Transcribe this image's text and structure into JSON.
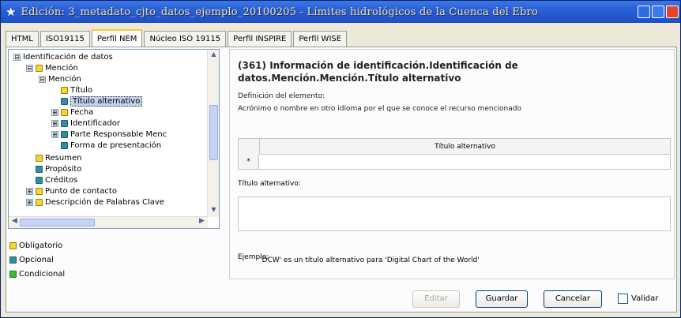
{
  "window": {
    "title": "Edición: 3_metadato_cjto_datos_ejemplo_20100205 - Límites hidrológicos de la Cuenca del Ebro",
    "colors": {
      "titlebar": "#2a5fd6",
      "title_text": "#f5e4a0",
      "required": "#f5d33a",
      "optional": "#2f8fa0",
      "conditional": "#3aba3a"
    }
  },
  "tabs": [
    {
      "label": "HTML",
      "active": false
    },
    {
      "label": "ISO19115",
      "active": false
    },
    {
      "label": "Perfil NEM",
      "active": true
    },
    {
      "label": "Núcleo ISO 19115",
      "active": false
    },
    {
      "label": "Perfil INSPIRE",
      "active": false
    },
    {
      "label": "Perfil WISE",
      "active": false
    }
  ],
  "tree": {
    "nodes": [
      {
        "label": "Identificación de datos",
        "expander": "⊟",
        "icon": ""
      },
      {
        "label": "Mención",
        "expander": "⊟",
        "icon": "y"
      },
      {
        "label": "Mención",
        "expander": "⊟",
        "icon": ""
      },
      {
        "label": "Título",
        "expander": "",
        "icon": "y"
      },
      {
        "label": "Título alternativo",
        "expander": "",
        "icon": "b",
        "selected": true
      },
      {
        "label": "Fecha",
        "expander": "⊞",
        "icon": "y"
      },
      {
        "label": "Identificador",
        "expander": "⊞",
        "icon": "b"
      },
      {
        "label": "Parte Responsable Menc",
        "expander": "⊞",
        "icon": "b"
      },
      {
        "label": "Forma de presentación",
        "expander": "",
        "icon": "b"
      },
      {
        "label": "Resumen",
        "expander": "",
        "icon": "y"
      },
      {
        "label": "Propósito",
        "expander": "",
        "icon": "b"
      },
      {
        "label": "Créditos",
        "expander": "",
        "icon": "b"
      },
      {
        "label": "Punto de contacto",
        "expander": "⊞",
        "icon": "y"
      },
      {
        "label": "Descripción de Palabras Clave",
        "expander": "⊞",
        "icon": "y"
      }
    ]
  },
  "legend": [
    {
      "label": "Obligatorio",
      "icon": "y"
    },
    {
      "label": "Opcional",
      "icon": "b"
    },
    {
      "label": "Condicional",
      "icon": "g"
    }
  ],
  "detail": {
    "heading": "(361) Información de identificación.Identificación de datos.Mención.Mención.Título alternativo",
    "definition_label": "Definición del elemento:",
    "definition_text": "Acrónimo o nombre en otro idioma por el que se conoce el recurso mencionado",
    "table_header": "Título alternativo",
    "table_rowmark": "*",
    "alt_label": "Título alternativo:",
    "alt_value": "",
    "example_label": "Ejemplo:",
    "example_text": "'DCW' es un título alternativo para 'Digital Chart of the World'"
  },
  "buttons": {
    "edit": "Editar",
    "save": "Guardar",
    "cancel": "Cancelar",
    "validate": "Validar"
  }
}
